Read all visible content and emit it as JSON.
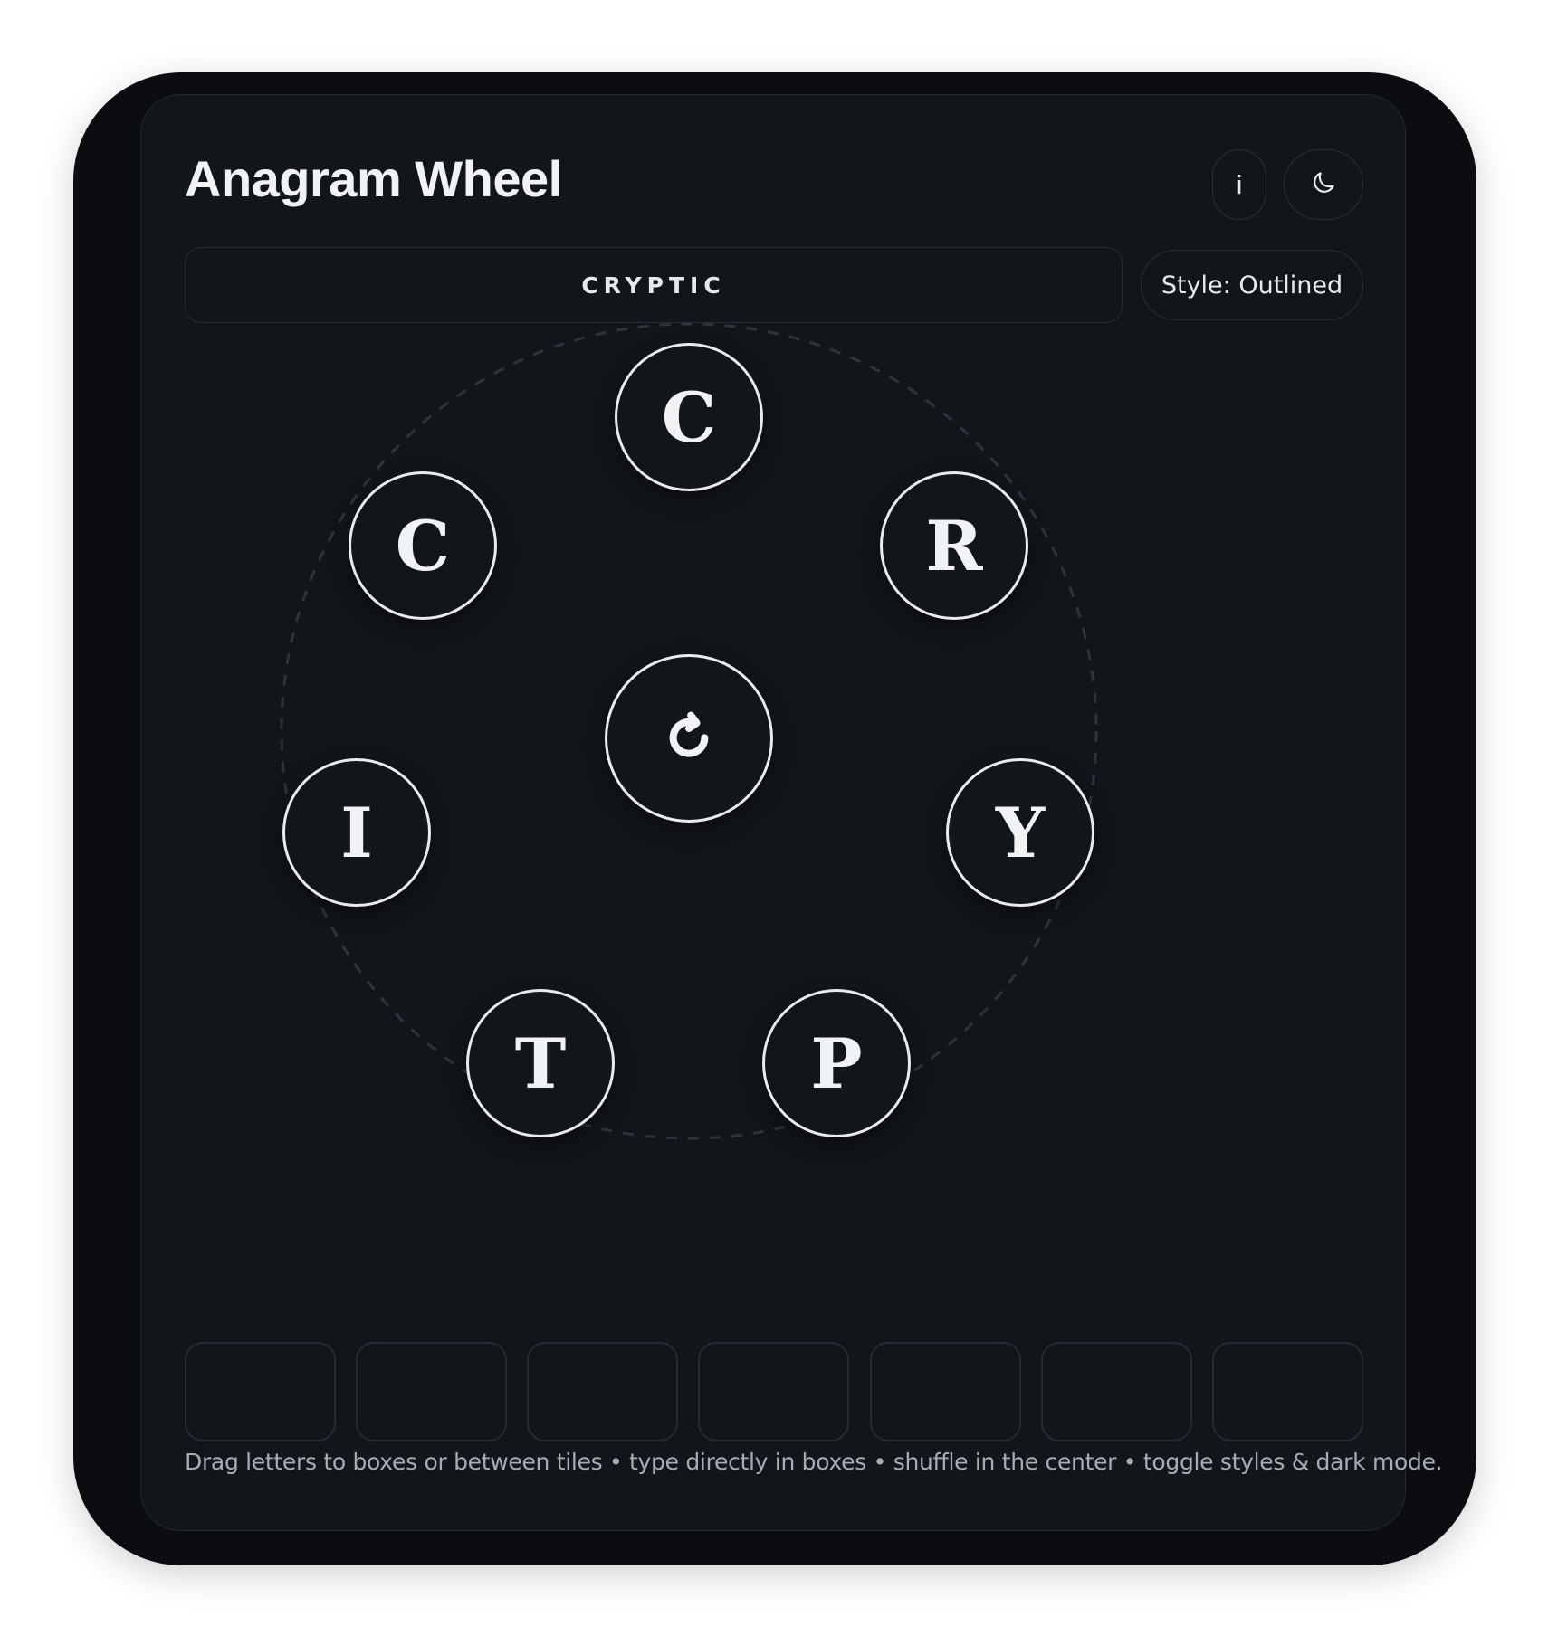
{
  "app": {
    "title": "Anagram Wheel"
  },
  "header": {
    "info_label": "i",
    "theme_icon": "moon-icon"
  },
  "word": {
    "value": "CRYPTIC"
  },
  "style_toggle": {
    "label": "Style: Outlined"
  },
  "wheel": {
    "center_icon": "shuffle-refresh-icon",
    "tiles": [
      {
        "letter": "C"
      },
      {
        "letter": "R"
      },
      {
        "letter": "Y"
      },
      {
        "letter": "P"
      },
      {
        "letter": "T"
      },
      {
        "letter": "I"
      },
      {
        "letter": "C"
      }
    ]
  },
  "answer_slots": [
    "",
    "",
    "",
    "",
    "",
    "",
    ""
  ],
  "footer": {
    "hint": "Drag letters to boxes or between tiles • type directly in boxes • shuffle in the center • toggle styles & dark mode."
  },
  "colors": {
    "background": "#0b0d10",
    "panel": "#12151a",
    "border": "#262b35",
    "text": "#f1f2f4",
    "muted_text": "#a7acb6"
  }
}
